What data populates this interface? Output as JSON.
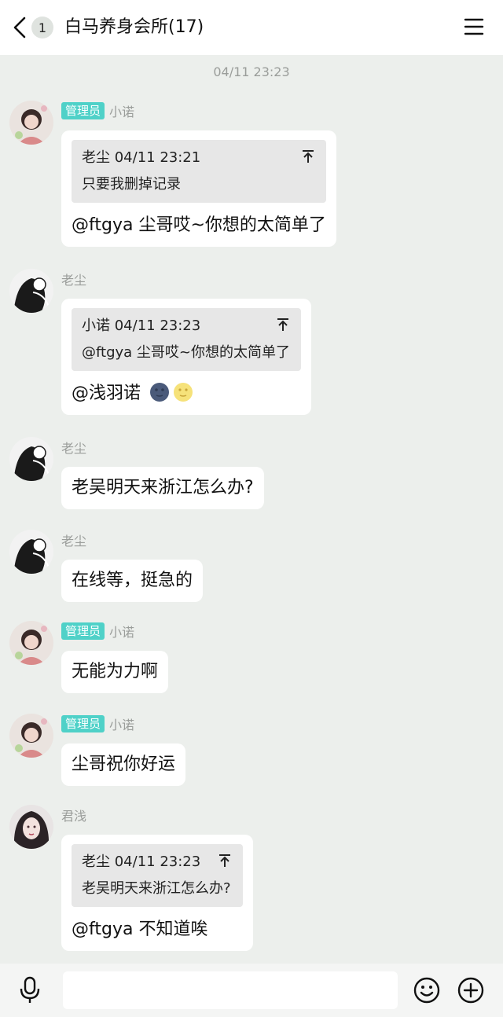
{
  "header": {
    "back_count": "1",
    "title": "白马养身会所(17)"
  },
  "chat": {
    "timestamp": "04/11 23:23",
    "messages": [
      {
        "badge": "管理员",
        "sender": "小诺",
        "quote_head": "老尘 04/11 23:21",
        "quote_body": "只要我删掉记录",
        "text": "@ftgya 尘哥哎~你想的太简单了"
      },
      {
        "sender": "老尘",
        "quote_head": "小诺 04/11 23:23",
        "quote_body": "@ftgya 尘哥哎~你想的太简单了",
        "text": "@浅羽诺",
        "emojis": [
          "new-moon-face-icon",
          "full-moon-face-icon"
        ]
      },
      {
        "sender": "老尘",
        "text": "老吴明天来浙江怎么办?"
      },
      {
        "sender": "老尘",
        "text": "在线等，挺急的"
      },
      {
        "badge": "管理员",
        "sender": "小诺",
        "text": "无能为力啊"
      },
      {
        "badge": "管理员",
        "sender": "小诺",
        "text": "尘哥祝你好运"
      },
      {
        "sender": "君浅",
        "quote_head": "老尘 04/11 23:23",
        "quote_body": "老吴明天来浙江怎么办?",
        "text": "@ftgya 不知道唉"
      }
    ]
  },
  "input": {
    "placeholder": ""
  },
  "icons": {
    "back": "chevron-left-icon",
    "menu": "menu-icon",
    "pin": "pin-top-icon",
    "mic": "microphone-icon",
    "emoji": "emoji-icon",
    "plus": "plus-circle-icon"
  },
  "colors": {
    "background": "#ecefec",
    "admin_badge": "#4fd1c8",
    "bubble": "#ffffff"
  }
}
